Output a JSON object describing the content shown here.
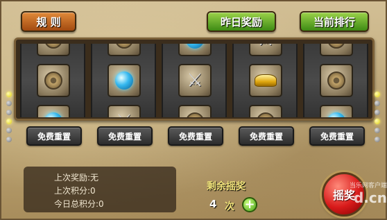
{
  "header": {
    "rules_label": "规 则",
    "yesterday_reward_label": "昨日奖励",
    "current_rank_label": "当前排行"
  },
  "reels": [
    {
      "top_icon": "coin-icon",
      "mid_icon": "coin-icon",
      "bot_icon": "orb-icon",
      "reset_label": "免费重置"
    },
    {
      "top_icon": "coin-icon",
      "mid_icon": "orb-icon",
      "bot_icon": "sword-icon",
      "reset_label": "免费重置"
    },
    {
      "top_icon": "orb-icon",
      "mid_icon": "sword-icon",
      "bot_icon": "coin-icon",
      "reset_label": "免费重置"
    },
    {
      "top_icon": "sword-icon",
      "mid_icon": "ingot-icon",
      "bot_icon": "coin-icon",
      "reset_label": "免费重置"
    },
    {
      "top_icon": "coin-icon",
      "mid_icon": "coin-icon",
      "bot_icon": "orb-icon",
      "reset_label": "免费重置"
    }
  ],
  "info": {
    "last_reward": "上次奖励:无",
    "last_score": "上次积分:0",
    "today_total": "今日总积分:0"
  },
  "remaining": {
    "label": "剩余摇奖",
    "count": "4",
    "unit": "次"
  },
  "spin_label": "摇奖",
  "watermark": {
    "text": "d.cn",
    "subtext": "当乐网客户端"
  },
  "colors": {
    "rules_button": "#c0621f",
    "green_button": "#5aa520",
    "spin_button": "#d81a1a",
    "highlight_text": "#f0e27a"
  }
}
